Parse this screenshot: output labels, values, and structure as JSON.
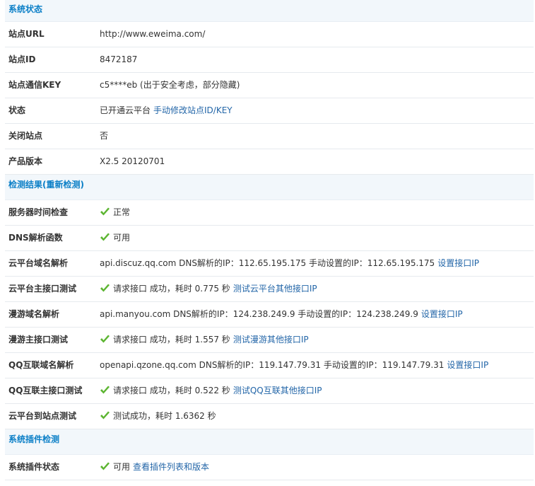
{
  "sections": {
    "status": {
      "title": "系统状态",
      "rows": {
        "site_url": {
          "label": "站点URL",
          "value": "http://www.eweima.com/"
        },
        "site_id": {
          "label": "站点ID",
          "value": "8472187"
        },
        "site_key": {
          "label": "站点通信KEY",
          "value": "c5****eb (出于安全考虑，部分隐藏)"
        },
        "state": {
          "label": "状态",
          "value": "已开通云平台",
          "link": "手动修改站点ID/KEY"
        },
        "close_site": {
          "label": "关闭站点",
          "value": "否"
        },
        "version": {
          "label": "产品版本",
          "value": "X2.5 20120701"
        }
      }
    },
    "check": {
      "title": "检测结果",
      "recheck_open": "(",
      "recheck_link": "重新检测",
      "recheck_close": ")",
      "rows": {
        "server_time": {
          "label": "服务器时间检查",
          "value": "正常"
        },
        "dns_func": {
          "label": "DNS解析函数",
          "value": "可用"
        },
        "cloud_dns": {
          "label": "云平台域名解析",
          "value": "api.discuz.qq.com DNS解析的IP：112.65.195.175 手动设置的IP：112.65.195.175",
          "link": "设置接口IP"
        },
        "cloud_api": {
          "label": "云平台主接口测试",
          "value": "请求接口 成功，耗时 0.775 秒",
          "link": "测试云平台其他接口IP"
        },
        "manyou_dns": {
          "label": "漫游域名解析",
          "value": "api.manyou.com DNS解析的IP：124.238.249.9 手动设置的IP：124.238.249.9",
          "link": "设置接口IP"
        },
        "manyou_api": {
          "label": "漫游主接口测试",
          "value": "请求接口 成功，耗时 1.557 秒",
          "link": "测试漫游其他接口IP"
        },
        "qq_dns": {
          "label": "QQ互联域名解析",
          "value": "openapi.qzone.qq.com DNS解析的IP：119.147.79.31 手动设置的IP：119.147.79.31",
          "link": "设置接口IP"
        },
        "qq_api": {
          "label": "QQ互联主接口测试",
          "value": "请求接口 成功，耗时 0.522 秒",
          "link": "测试QQ互联其他接口IP"
        },
        "cloud_to_site": {
          "label": "云平台到站点测试",
          "value": "测试成功，耗时 1.6362 秒"
        }
      }
    },
    "plugin": {
      "title": "系统插件检测",
      "rows": {
        "plugin_state": {
          "label": "系统插件状态",
          "value": "可用",
          "link": "查看插件列表和版本"
        }
      }
    }
  },
  "icons": {
    "ok": "green-check-icon"
  },
  "colors": {
    "section_title": "#0b7fc7",
    "link": "#2366a8",
    "check": "#5cb531",
    "section_bg": "#f2f7fb"
  }
}
